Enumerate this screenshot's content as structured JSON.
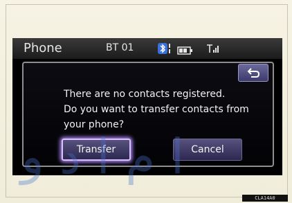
{
  "screen": {
    "title": "Phone",
    "device": "BT 01",
    "icons": [
      "bluetooth-icon",
      "battery-icon",
      "signal-icon"
    ]
  },
  "dialog": {
    "back_icon": "return-arrow-icon",
    "message_lines": [
      "There are no contacts registered.",
      "Do you want to transfer contacts from",
      "your phone?"
    ],
    "buttons": {
      "transfer": "Transfer",
      "cancel": "Cancel"
    }
  },
  "watermark": "ا م ا د و",
  "code": "CLA14A0",
  "colors": {
    "screen_bg": "#000000",
    "button": "#3f3a66",
    "selected_glow": "#b78eff",
    "page_bg": "#f3f0df"
  }
}
